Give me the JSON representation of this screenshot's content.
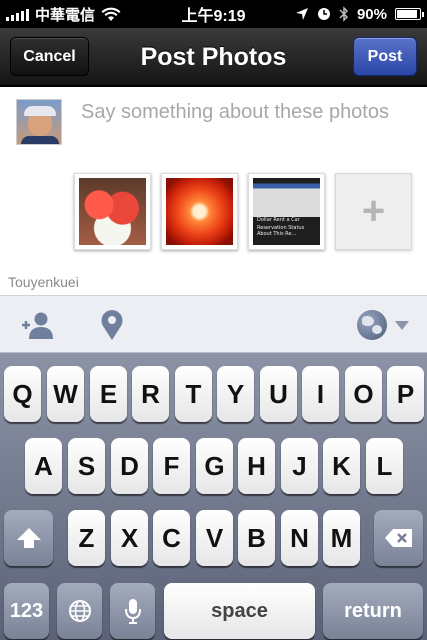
{
  "status_bar": {
    "carrier": "中華電信",
    "time": "上午9:19",
    "battery": "90%",
    "battery_level": 0.9
  },
  "nav": {
    "title": "Post Photos",
    "cancel_label": "Cancel",
    "post_label": "Post"
  },
  "compose": {
    "placeholder": "Say something about these photos",
    "add_photo_label": "+",
    "username": "Touyenkuei",
    "photos": [
      {
        "name": "watermelon-photo"
      },
      {
        "name": "orange-photo"
      },
      {
        "name": "screenshot-photo",
        "lines": [
          "Dollar Rent a Car",
          "Reservation Status About This Re..."
        ]
      }
    ]
  },
  "toolbar": {
    "icons": [
      "tag-person-icon",
      "location-pin-icon",
      "globe-icon"
    ]
  },
  "keyboard": {
    "row1": [
      "Q",
      "W",
      "E",
      "R",
      "T",
      "Y",
      "U",
      "I",
      "O",
      "P"
    ],
    "row2": [
      "A",
      "S",
      "D",
      "F",
      "G",
      "H",
      "J",
      "K",
      "L"
    ],
    "row3": [
      "Z",
      "X",
      "C",
      "V",
      "B",
      "N",
      "M"
    ],
    "numbers_label": "123",
    "space_label": "space",
    "return_label": "return"
  },
  "colors": {
    "post_button": "#3a56b8",
    "keyboard_bg": "#7a8296"
  }
}
